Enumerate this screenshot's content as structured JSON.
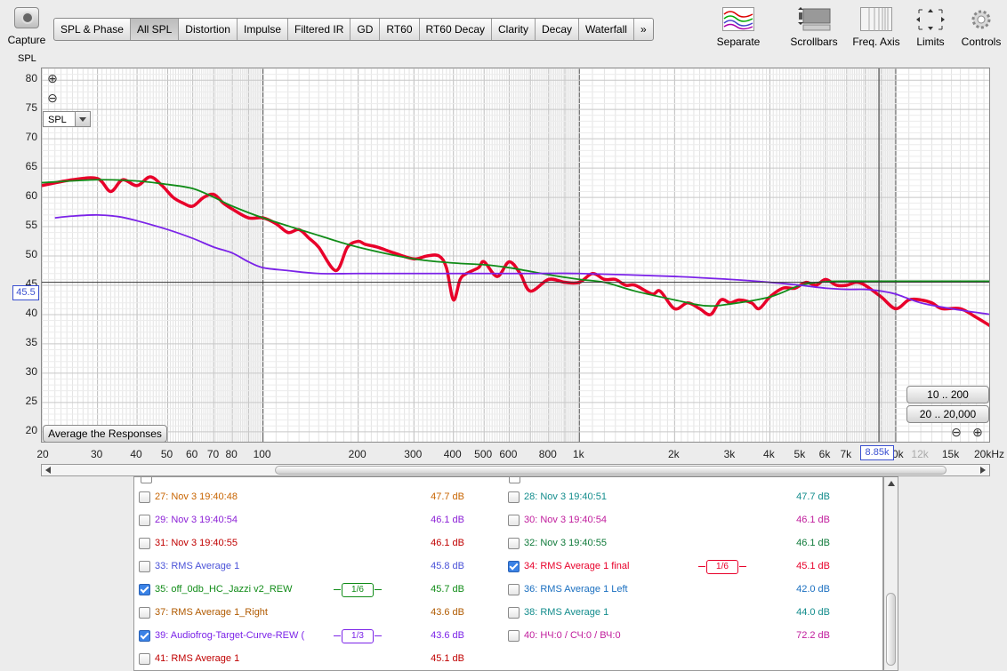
{
  "toolbar": {
    "capture": "Capture",
    "tabs": [
      "SPL & Phase",
      "All SPL",
      "Distortion",
      "Impulse",
      "Filtered IR",
      "GD",
      "RT60",
      "RT60 Decay",
      "Clarity",
      "Decay",
      "Waterfall",
      "»"
    ],
    "active_tab": "All SPL",
    "tools": [
      "Separate",
      "Scrollbars",
      "Freq. Axis",
      "Limits",
      "Controls"
    ]
  },
  "graph": {
    "unit_label": "SPL",
    "y_ticks": [
      "80",
      "75",
      "70",
      "65",
      "60",
      "55",
      "50",
      "45",
      "40",
      "35",
      "30",
      "25",
      "20"
    ],
    "x_ticks": [
      "20",
      "30",
      "40",
      "50",
      "60",
      "70",
      "80",
      "100",
      "200",
      "300",
      "400",
      "500",
      "600",
      "800",
      "1k",
      "2k",
      "3k",
      "4k",
      "5k",
      "6k",
      "7k",
      "10k",
      "15k",
      "20kHz"
    ],
    "x_ticks_dim": [
      "10k",
      "12k",
      "15k"
    ],
    "spl_select": "SPL",
    "cursor_y": "45.5",
    "cursor_x": "8.85k",
    "avg_button": "Average the Responses",
    "range_btn_1": "10 .. 200",
    "range_btn_2": "20 .. 20,000",
    "colors": {
      "red": "#e8002a",
      "green": "#118c18",
      "purple": "#7b23e8",
      "blue_cursor": "#3a4fd0"
    }
  },
  "chart_data": {
    "type": "line",
    "x_scale": "log",
    "xlim": [
      20,
      20000
    ],
    "ylim": [
      18,
      82
    ],
    "xlabel": "",
    "ylabel": "SPL",
    "series": [
      {
        "name": "34: RMS Average 1 final",
        "color": "#e8002a",
        "x": [
          20,
          25,
          30,
          33,
          36,
          40,
          44,
          48,
          52,
          56,
          60,
          65,
          70,
          75,
          80,
          90,
          100,
          110,
          120,
          130,
          140,
          150,
          170,
          185,
          200,
          210,
          230,
          260,
          300,
          330,
          360,
          380,
          400,
          420,
          440,
          480,
          500,
          550,
          600,
          650,
          700,
          800,
          900,
          1000,
          1100,
          1200,
          1300,
          1400,
          1500,
          1700,
          1800,
          2000,
          2200,
          2400,
          2600,
          2800,
          3000,
          3200,
          3500,
          3700,
          4000,
          4400,
          4800,
          5200,
          5600,
          6000,
          6500,
          7000,
          7500,
          8000,
          9000,
          10000,
          11000,
          12000,
          13000,
          14000,
          16000,
          18000,
          20000
        ],
        "y": [
          62,
          63,
          63.2,
          61,
          63,
          62,
          63.5,
          62,
          60,
          59,
          58.5,
          60,
          60.5,
          59,
          58,
          56.5,
          56.5,
          55.5,
          54,
          54.5,
          53,
          51.5,
          47.5,
          51.5,
          52.5,
          52,
          51.5,
          50.5,
          49.5,
          50,
          50,
          48,
          42.5,
          46,
          47,
          48,
          49,
          46.5,
          49,
          47,
          44,
          46,
          45.5,
          45.5,
          47,
          46,
          46,
          45,
          45,
          43.5,
          44,
          41,
          42,
          41,
          40,
          42.5,
          42,
          42.5,
          42,
          41,
          43,
          44.5,
          44.5,
          45.5,
          45,
          46,
          45,
          45,
          45.5,
          45,
          43,
          41,
          42.5,
          42.5,
          42,
          41,
          41,
          39.5,
          38
        ]
      },
      {
        "name": "35: off_0db_HC_Jazzi v2_REW",
        "color": "#118c18",
        "x": [
          20,
          30,
          40,
          50,
          60,
          70,
          80,
          100,
          150,
          200,
          300,
          400,
          500,
          600,
          800,
          1000,
          1200,
          1500,
          2000,
          2500,
          3000,
          4000,
          5000,
          6000,
          7000,
          8000,
          9000,
          10000,
          20000
        ],
        "y": [
          62.5,
          63,
          62.8,
          62.2,
          61.5,
          60,
          58.5,
          56.5,
          53.5,
          51.5,
          49.5,
          48.8,
          48.5,
          48,
          46.8,
          46,
          45.5,
          44,
          42.5,
          41.5,
          41.8,
          43,
          45,
          45.6,
          45.7,
          45.7,
          45.7,
          45.7,
          45.7
        ]
      },
      {
        "name": "39: Audiofrog-Target-Curve-REW (",
        "color": "#7b23e8",
        "x": [
          22,
          25,
          30,
          35,
          40,
          50,
          60,
          70,
          80,
          90,
          100,
          120,
          150,
          200,
          300,
          500,
          700,
          1000,
          2000,
          3000,
          4000,
          5000,
          6000,
          7000,
          8000,
          9000,
          10000,
          12000,
          15000,
          20000
        ],
        "y": [
          56.5,
          56.8,
          57,
          56.7,
          56,
          54.5,
          53,
          51.5,
          50.5,
          49,
          48,
          47.5,
          47,
          47,
          47,
          47,
          47,
          47,
          46.5,
          46,
          45.5,
          45,
          44.5,
          44.3,
          44.3,
          44,
          43.5,
          42,
          41,
          40
        ]
      }
    ]
  },
  "measurements": [
    {
      "label": "27: Nov 3 19:40:48",
      "value": "47.7 dB",
      "color": "#c86400",
      "checked": false
    },
    {
      "label": "28: Nov 3 19:40:51",
      "value": "47.7 dB",
      "color": "#128c8c",
      "checked": false
    },
    {
      "label": "29: Nov 3 19:40:54",
      "value": "46.1 dB",
      "color": "#8b1fd6",
      "checked": false
    },
    {
      "label": "30: Nov 3 19:40:54",
      "value": "46.1 dB",
      "color": "#c01c9c",
      "checked": false
    },
    {
      "label": "31: Nov 3 19:40:55",
      "value": "46.1 dB",
      "color": "#c00000",
      "checked": false
    },
    {
      "label": "32: Nov 3 19:40:55",
      "value": "46.1 dB",
      "color": "#0f7a3a",
      "checked": false
    },
    {
      "label": "33: RMS Average 1",
      "value": "45.8 dB",
      "color": "#4a52d8",
      "checked": false
    },
    {
      "label": "34: RMS Average 1 final",
      "value": "45.1 dB",
      "color": "#e8002a",
      "checked": true,
      "smoothing": "1/6"
    },
    {
      "label": "35: off_0db_HC_Jazzi v2_REW",
      "value": "45.7 dB",
      "color": "#118c18",
      "checked": true,
      "smoothing": "1/6"
    },
    {
      "label": "36: RMS Average 1 Left",
      "value": "42.0 dB",
      "color": "#1a6fc0",
      "checked": false
    },
    {
      "label": "37: RMS Average 1_Right",
      "value": "43.6 dB",
      "color": "#b05a00",
      "checked": false
    },
    {
      "label": "38: RMS Average 1",
      "value": "44.0 dB",
      "color": "#128c8c",
      "checked": false
    },
    {
      "label": "39: Audiofrog-Target-Curve-REW (",
      "value": "43.6 dB",
      "color": "#7b23e8",
      "checked": true,
      "smoothing": "1/3"
    },
    {
      "label": "40: НЧ:0 / СЧ:0 / ВЧ:0",
      "value": "72.2 dB",
      "color": "#c01c9c",
      "checked": false
    },
    {
      "label": "41: RMS Average 1",
      "value": "45.1 dB",
      "color": "#c00000",
      "checked": false
    }
  ]
}
